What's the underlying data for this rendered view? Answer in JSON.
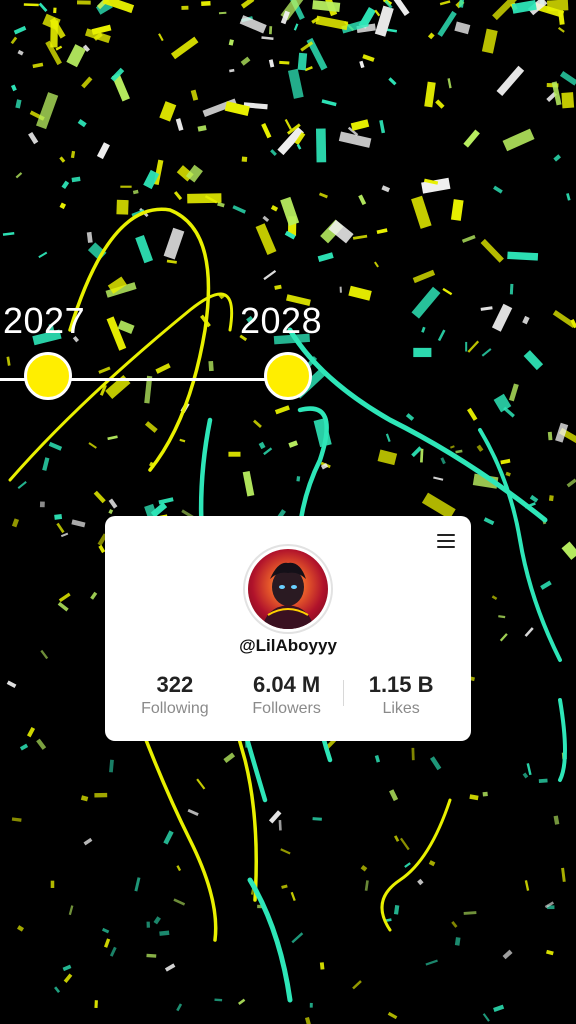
{
  "timeline": {
    "years": [
      "2027",
      "2028"
    ],
    "dot_color": "#ffee00"
  },
  "profile": {
    "username": "@LilAboyyy",
    "menu_icon": "hamburger-menu-icon",
    "avatar_icon": "profile-avatar-image",
    "stats": [
      {
        "value": "322",
        "label": "Following"
      },
      {
        "value": "6.04 M",
        "label": "Followers"
      },
      {
        "value": "1.15 B",
        "label": "Likes"
      }
    ]
  },
  "colors": {
    "background": "#000000",
    "confetti_yellow": "#e8f000",
    "confetti_teal": "#2ee6b8",
    "confetti_white": "#f2f2f2",
    "confetti_lime": "#b8ee60"
  }
}
